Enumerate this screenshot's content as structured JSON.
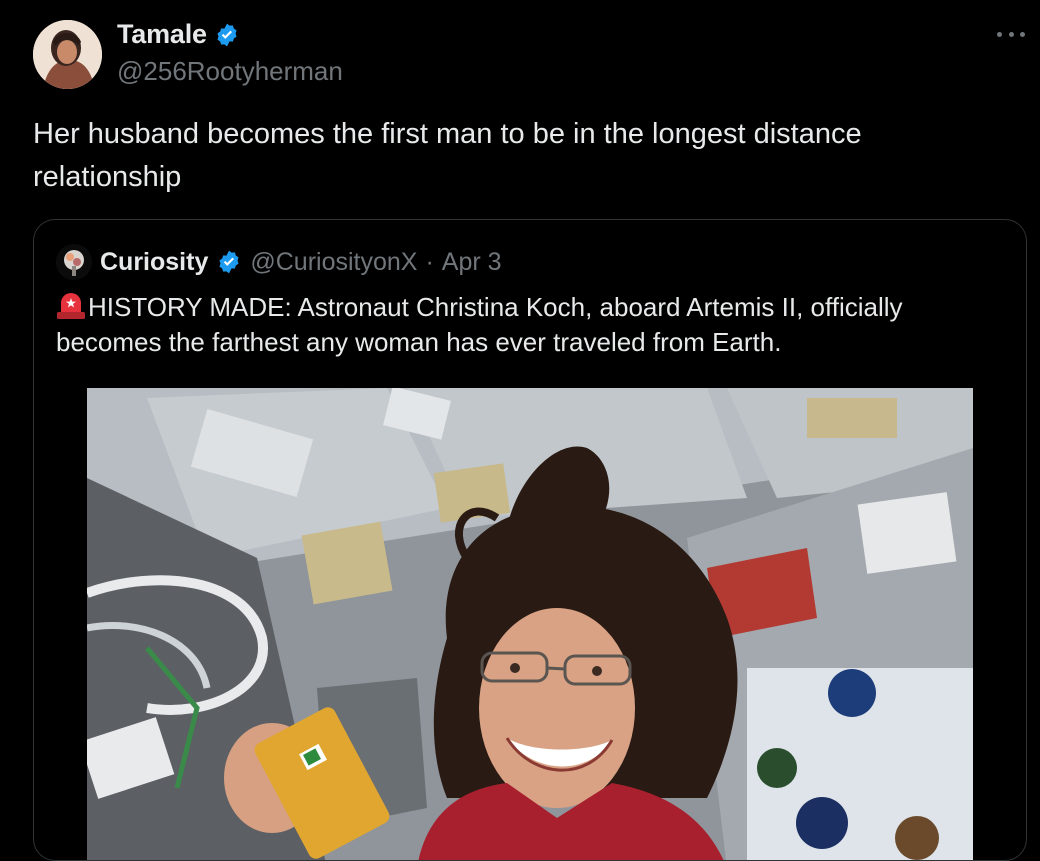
{
  "tweet": {
    "author": {
      "display_name": "Tamale",
      "handle": "@256Rootyherman",
      "verified": true
    },
    "text": "Her husband becomes the first man to be in the longest distance relationship",
    "more_icon": "more-horizontal-icon"
  },
  "quoted": {
    "author": {
      "display_name": "Curiosity",
      "handle": "@CuriosityonX",
      "verified": true
    },
    "separator": "·",
    "date": "Apr 3",
    "emoji": "police-car-light-icon",
    "text": "HISTORY MADE: Astronaut Christina Koch, aboard Artemis II, officially becomes the farthest any woman has ever traveled from Earth.",
    "media": {
      "type": "photo",
      "subject": "astronaut-photo"
    }
  },
  "colors": {
    "background": "#000000",
    "text_primary": "#e7e9ea",
    "text_secondary": "#71767b",
    "verified_blue": "#1d9bf0",
    "border": "#2f3336"
  }
}
